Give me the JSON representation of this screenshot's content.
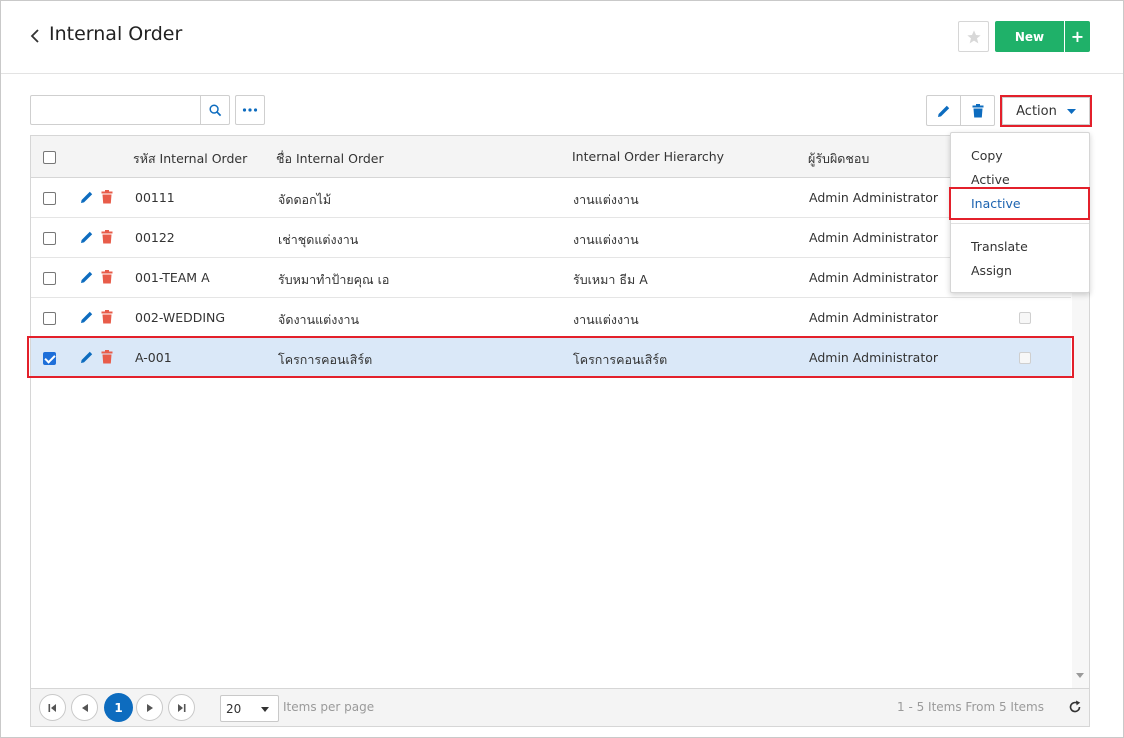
{
  "header": {
    "title": "Internal Order",
    "new_label": "New",
    "new_plus": "+"
  },
  "toolbar": {
    "search_value": "",
    "search_placeholder": "",
    "action_label": "Action"
  },
  "grid": {
    "columns": [
      "รหัส Internal Order",
      "ชื่อ Internal Order",
      "Internal Order Hierarchy",
      "ผู้รับผิดชอบ"
    ],
    "rows": [
      {
        "code": "00111",
        "name": "จัดดอกไม้",
        "hierarchy": "งานแต่งงาน",
        "owner": "Admin Administrator",
        "checked": false
      },
      {
        "code": "00122",
        "name": "เช่าชุดแต่งงาน",
        "hierarchy": "งานแต่งงาน",
        "owner": "Admin Administrator",
        "checked": false
      },
      {
        "code": "001-TEAM A",
        "name": "รับหมาทำป้ายคุณ เอ",
        "hierarchy": "รับเหมา ธีม A",
        "owner": "Admin Administrator",
        "checked": false
      },
      {
        "code": "002-WEDDING",
        "name": "จัดงานแต่งงาน",
        "hierarchy": "งานแต่งงาน",
        "owner": "Admin Administrator",
        "checked": false
      },
      {
        "code": "A-001",
        "name": "โครการคอนเสิร์ต",
        "hierarchy": "โครการคอนเสิร์ต",
        "owner": "Admin Administrator",
        "checked": true
      }
    ]
  },
  "pager": {
    "current_page": "1",
    "page_size": "20",
    "items_per_page_label": "Items per page",
    "summary": "1 - 5 Items From 5 Items"
  },
  "action_menu": {
    "items": [
      "Copy",
      "Active",
      "Inactive",
      "Translate",
      "Assign"
    ],
    "highlighted": "Inactive"
  },
  "colors": {
    "primary_green": "#1fb169",
    "primary_blue": "#0d6cbf",
    "highlight_red": "#e3202b",
    "selected_row": "#dae8f8",
    "delete_red": "#e85c4a"
  }
}
